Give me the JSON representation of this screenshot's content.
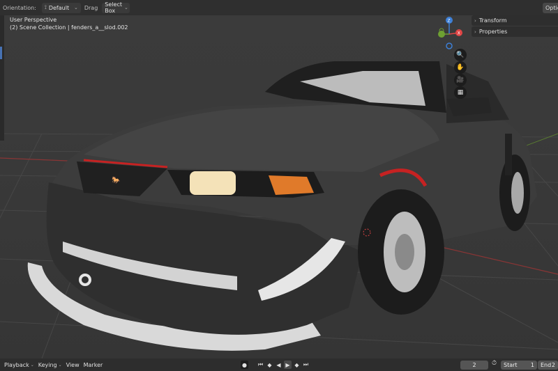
{
  "header": {
    "orientation_label": "Orientation:",
    "orientation_value": "Default",
    "drag_label": "Drag",
    "drag_value": "Select Box",
    "options_label": "Options"
  },
  "viewport": {
    "perspective_label": "User Perspective",
    "collection_label": "(2) Scene Collection | fenders_a__slod.002",
    "gizmo_axes": [
      "Z",
      "X",
      "Y"
    ],
    "nav_icons": [
      "zoom-icon",
      "hand-icon",
      "camera-icon",
      "grid-icon"
    ],
    "colors": {
      "x_axis": "#e04545",
      "y_axis": "#6ea032",
      "z_axis": "#3d7fd6",
      "grid": "#444444"
    }
  },
  "npanel": {
    "transform_label": "Transform",
    "properties_label": "Properties"
  },
  "timeline": {
    "playback_label": "Playback",
    "keying_label": "Keying",
    "view_label": "View",
    "marker_label": "Marker",
    "current_frame": "2",
    "start_label": "Start",
    "start_value": "1",
    "end_label": "End",
    "end_value": "2"
  }
}
